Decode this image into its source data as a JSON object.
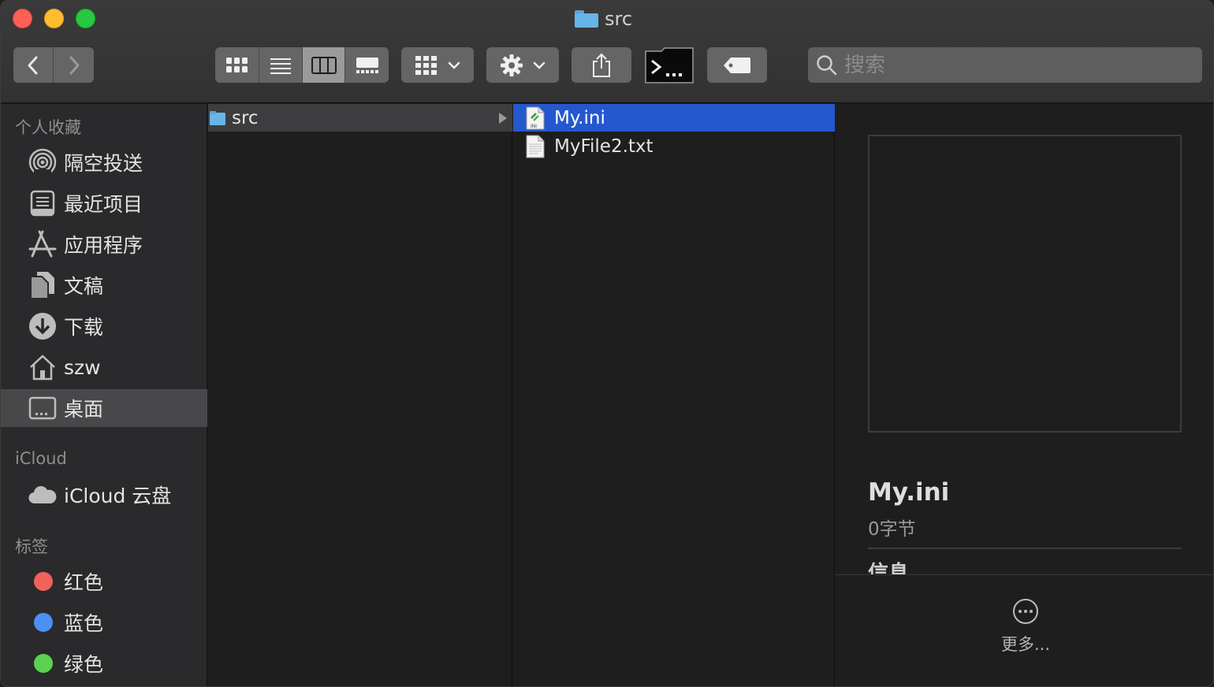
{
  "window": {
    "title": "src"
  },
  "toolbar": {
    "back_label": "‹",
    "forward_label": "›",
    "search": {
      "placeholder": "搜索",
      "value": ""
    }
  },
  "sidebar": {
    "favorites_title": "个人收藏",
    "favorites": [
      {
        "label": "隔空投送",
        "icon": "airdrop-icon"
      },
      {
        "label": "最近项目",
        "icon": "recents-icon"
      },
      {
        "label": "应用程序",
        "icon": "applications-icon"
      },
      {
        "label": "文稿",
        "icon": "documents-icon"
      },
      {
        "label": "下载",
        "icon": "downloads-icon"
      },
      {
        "label": "szw",
        "icon": "home-icon"
      },
      {
        "label": "桌面",
        "icon": "desktop-icon",
        "selected": true
      }
    ],
    "icloud_title": "iCloud",
    "icloud": [
      {
        "label": "iCloud 云盘",
        "icon": "cloud-icon"
      }
    ],
    "tags_title": "标签",
    "tags": [
      {
        "label": "红色",
        "color": "#f0625a"
      },
      {
        "label": "蓝色",
        "color": "#4a90f5"
      },
      {
        "label": "绿色",
        "color": "#5bd14f"
      }
    ]
  },
  "columns": {
    "column1": [
      {
        "name": "src",
        "type": "folder",
        "selected": true
      }
    ],
    "column2": [
      {
        "name": "My.ini",
        "type": "ini-file",
        "selected": true
      },
      {
        "name": "MyFile2.txt",
        "type": "text-file",
        "selected": false
      }
    ]
  },
  "preview": {
    "name": "My.ini",
    "size": "0字节",
    "info_heading": "信息",
    "more_label": "更多..."
  },
  "colors": {
    "selection_blue": "#2458cf",
    "folder_blue": "#66b5e8"
  }
}
